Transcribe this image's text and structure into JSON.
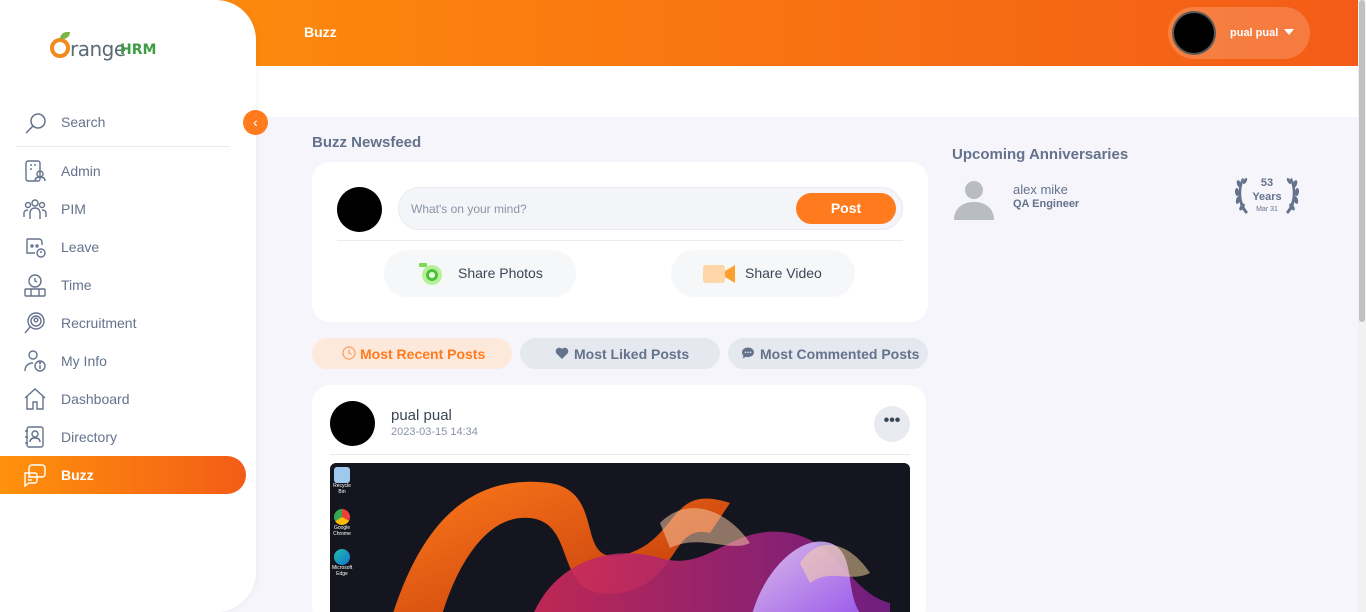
{
  "app": {
    "logo_text": "range",
    "logo_suffix": "HRM"
  },
  "header": {
    "page_title": "Buzz",
    "user_name": "pual pual"
  },
  "sidebar": {
    "search_label": "Search",
    "items": [
      {
        "label": "Admin",
        "icon": "admin-icon"
      },
      {
        "label": "PIM",
        "icon": "pim-icon"
      },
      {
        "label": "Leave",
        "icon": "leave-icon"
      },
      {
        "label": "Time",
        "icon": "time-icon"
      },
      {
        "label": "Recruitment",
        "icon": "recruitment-icon"
      },
      {
        "label": "My Info",
        "icon": "my-info-icon"
      },
      {
        "label": "Dashboard",
        "icon": "dashboard-icon"
      },
      {
        "label": "Directory",
        "icon": "directory-icon"
      },
      {
        "label": "Buzz",
        "icon": "buzz-icon",
        "active": true
      }
    ],
    "collapse_glyph": "‹"
  },
  "main": {
    "section_title": "Buzz Newsfeed",
    "composer": {
      "placeholder": "What's on your mind?",
      "post_label": "Post",
      "share_photos": "Share Photos",
      "share_video": "Share Video"
    },
    "tabs": [
      {
        "label": "Most Recent Posts",
        "active": true
      },
      {
        "label": "Most Liked Posts"
      },
      {
        "label": "Most Commented Posts"
      }
    ],
    "post": {
      "author": "pual pual",
      "timestamp": "2023-03-15 14:34",
      "more_glyph": "•••",
      "desktop_icons": [
        "Recycle Bin",
        "Google Chrome",
        "Microsoft Edge"
      ]
    }
  },
  "anniversaries": {
    "title": "Upcoming Anniversaries",
    "items": [
      {
        "name": "alex mike",
        "role": "QA Engineer",
        "years": "53",
        "years_label": "Years",
        "date": "Mar 31"
      }
    ]
  },
  "colors": {
    "accent": "#ff7b1d",
    "header_start": "#ff920b",
    "header_end": "#f35c17",
    "text": "#64728c"
  }
}
